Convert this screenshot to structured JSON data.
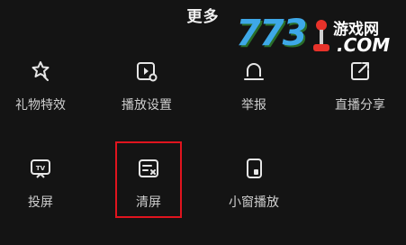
{
  "panel": {
    "title": "更多"
  },
  "watermark": {
    "number": "773",
    "site_cn": "游戏网",
    "site_en": ".COM"
  },
  "items": [
    {
      "label": "礼物特效",
      "icon": "gift-effect-icon"
    },
    {
      "label": "播放设置",
      "icon": "play-settings-icon"
    },
    {
      "label": "举报",
      "icon": "report-icon"
    },
    {
      "label": "直播分享",
      "icon": "share-icon"
    },
    {
      "label": "投屏",
      "icon": "tv-cast-icon"
    },
    {
      "label": "清屏",
      "icon": "clear-screen-icon"
    },
    {
      "label": "小窗播放",
      "icon": "mini-window-icon"
    }
  ],
  "colors": {
    "background": "#141414",
    "text": "#cfcfcf",
    "highlight": "#e0141e"
  }
}
